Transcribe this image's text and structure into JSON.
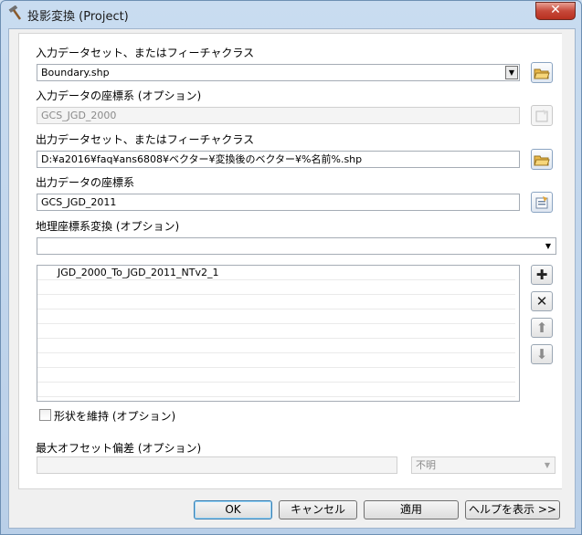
{
  "window": {
    "title": "投影変換 (Project)",
    "close_label": "✕"
  },
  "form": {
    "input_dataset": {
      "label": "入力データセット、またはフィーチャクラス",
      "value": "Boundary.shp"
    },
    "input_crs": {
      "label": "入力データの座標系 (オプション)",
      "value": "GCS_JGD_2000"
    },
    "output_dataset": {
      "label": "出力データセット、またはフィーチャクラス",
      "value": "D:¥a2016¥faq¥ans6808¥ベクター¥変換後のベクター¥%名前%.shp"
    },
    "output_crs": {
      "label": "出力データの座標系",
      "value": "GCS_JGD_2011"
    },
    "geo_transform": {
      "label": "地理座標系変換 (オプション)",
      "value": "",
      "items": [
        "JGD_2000_To_JGD_2011_NTv2_1",
        "",
        "",
        "",
        "",
        "",
        "",
        "",
        ""
      ]
    },
    "preserve_shape": {
      "label": "形状を維持 (オプション)",
      "checked": false
    },
    "max_offset": {
      "label": "最大オフセット偏差 (オプション)",
      "value": "",
      "unit": "不明"
    }
  },
  "side_buttons": {
    "add": "✚",
    "remove": "✕",
    "up": "⬆",
    "down": "⬇"
  },
  "buttons": {
    "ok": "OK",
    "cancel": "キャンセル",
    "apply": "適用",
    "help": "ヘルプを表示 >>"
  }
}
